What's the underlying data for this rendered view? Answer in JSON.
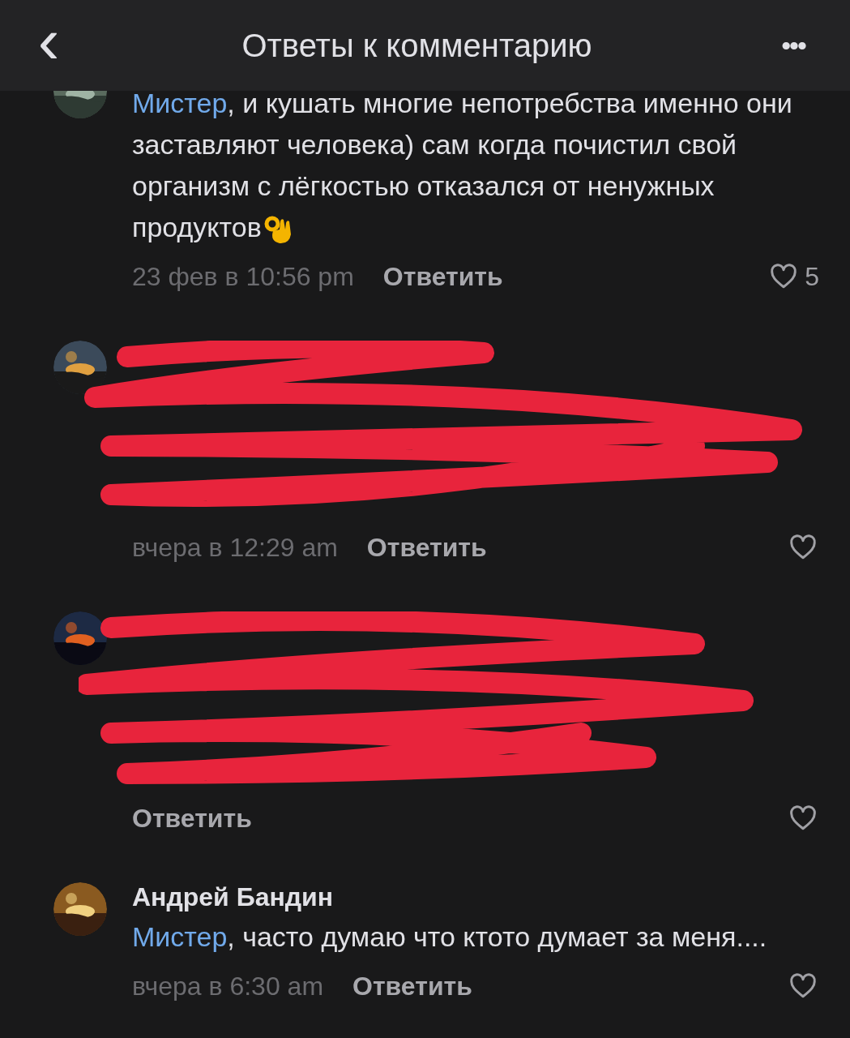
{
  "header": {
    "back": "‹",
    "title": "Ответы к комментарию",
    "menu": "•••"
  },
  "comments": [
    {
      "kind": "text",
      "mention": "Мистер",
      "text": ", и кушать многие непотребства именно они заставляют человека) сам когда почистил свой организм с лёгкостью отказался от ненужных продуктов",
      "emoji": true,
      "time": "23 фев в 10:56 pm",
      "reply": "Ответить",
      "likes": "5"
    },
    {
      "kind": "redacted",
      "time": "вчера в 12:29 am",
      "reply": "Ответить"
    },
    {
      "kind": "redacted",
      "reply": "Ответить"
    },
    {
      "kind": "text",
      "author": "Андрей Бандин",
      "mention": "Мистер",
      "text": ", часто думаю что ктото думает за меня....",
      "emoji": false,
      "time": "вчера в 6:30 am",
      "reply": "Ответить"
    }
  ]
}
